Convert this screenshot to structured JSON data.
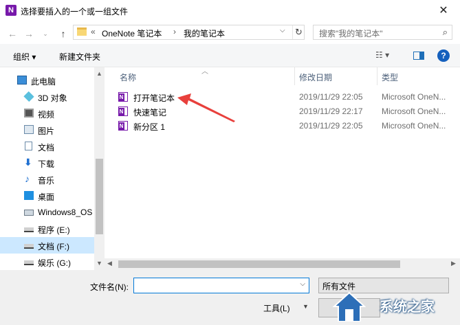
{
  "window": {
    "title": "选择要插入的一个或一组文件",
    "close_glyph": "✕"
  },
  "address": {
    "prefix": "«",
    "crumbs": [
      "OneNote 笔记本",
      "我的笔记本"
    ],
    "sep": "›"
  },
  "search": {
    "placeholder": "搜索\"我的笔记本\""
  },
  "toolbar": {
    "organize": "组织 ▾",
    "new_folder": "新建文件夹"
  },
  "sidebar": {
    "items": [
      {
        "label": "此电脑",
        "icon": "computer-icon"
      },
      {
        "label": "3D 对象",
        "icon": "cube-icon"
      },
      {
        "label": "视频",
        "icon": "video-icon"
      },
      {
        "label": "图片",
        "icon": "pictures-icon"
      },
      {
        "label": "文档",
        "icon": "documents-icon"
      },
      {
        "label": "下载",
        "icon": "download-icon"
      },
      {
        "label": "音乐",
        "icon": "music-icon"
      },
      {
        "label": "桌面",
        "icon": "desktop-icon"
      },
      {
        "label": "Windows8_OS",
        "icon": "drive-icon"
      },
      {
        "label": "程序 (E:)",
        "icon": "drive-icon"
      },
      {
        "label": "文档 (F:)",
        "icon": "drive-icon",
        "selected": true
      },
      {
        "label": "娱乐 (G:)",
        "icon": "drive-icon"
      }
    ]
  },
  "columns": {
    "name": "名称",
    "modified": "修改日期",
    "type": "类型"
  },
  "files": [
    {
      "name": "打开笔记本",
      "modified": "2019/11/29 22:05",
      "type": "Microsoft OneN..."
    },
    {
      "name": "快速笔记",
      "modified": "2019/11/29 22:17",
      "type": "Microsoft OneN..."
    },
    {
      "name": "新分区 1",
      "modified": "2019/11/29 22:05",
      "type": "Microsoft OneN..."
    }
  ],
  "bottom": {
    "filename_label": "文件名(N):",
    "filename_value": "",
    "filetype_value": "所有文件",
    "tools_label": "工具(L)"
  },
  "watermark": {
    "text": "系统之家"
  },
  "colors": {
    "onenote_purple": "#7719aa",
    "accent_blue": "#0078d7",
    "arrow_red": "#e8403c"
  }
}
